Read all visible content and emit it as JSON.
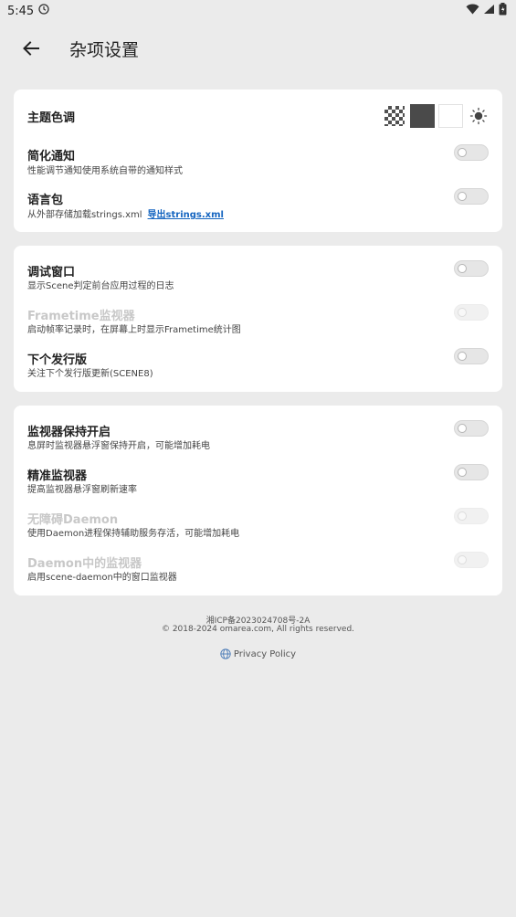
{
  "status_bar": {
    "time": "5:45"
  },
  "header": {
    "title": "杂项设置"
  },
  "card1": {
    "theme": {
      "title": "主题色调"
    },
    "simple_notify": {
      "title": "简化通知",
      "desc": "性能调节通知使用系统自带的通知样式",
      "enabled": false
    },
    "lang_pack": {
      "title": "语言包",
      "desc": "从外部存储加载strings.xml",
      "link": "导出strings.xml",
      "enabled": false
    }
  },
  "card2": {
    "debug_window": {
      "title": "调试窗口",
      "desc": "显示Scene判定前台应用过程的日志",
      "enabled": false
    },
    "frametime": {
      "title": "Frametime监视器",
      "desc": "启动帧率记录时，在屏幕上时显示Frametime统计图",
      "enabled": false,
      "disabled": true
    },
    "next_release": {
      "title": "下个发行版",
      "desc": "关注下个发行版更新(SCENE8)",
      "enabled": false
    }
  },
  "card3": {
    "keep_monitor": {
      "title": "监视器保持开启",
      "desc": "息屏时监视器悬浮窗保持开启，可能增加耗电",
      "enabled": false
    },
    "precise_monitor": {
      "title": "精准监视器",
      "desc": "提高监视器悬浮窗刷新速率",
      "enabled": false
    },
    "accessibility_daemon": {
      "title": "无障碍Daemon",
      "desc": "使用Daemon进程保持辅助服务存活，可能增加耗电",
      "enabled": false,
      "disabled": true
    },
    "daemon_monitor": {
      "title": "Daemon中的监视器",
      "desc": "启用scene-daemon中的窗口监视器",
      "enabled": false,
      "disabled": true
    }
  },
  "footer": {
    "icp": "湘ICP备2023024708号-2A",
    "copyright": "© 2018-2024 omarea.com, All rights reserved.",
    "privacy": "Privacy Policy"
  },
  "colors": {
    "background": "#ebebeb",
    "card": "#ffffff",
    "link": "#1565c0",
    "swatch_dark": "#4a4a4a"
  }
}
